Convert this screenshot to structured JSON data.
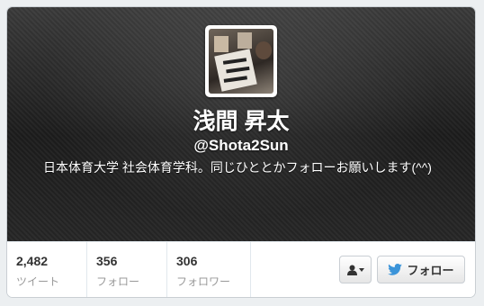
{
  "profile": {
    "name": "浅間 昇太",
    "handle": "@Shota2Sun",
    "bio": "日本体育大学 社会体育学科。同じひととかフォローお願いします(^^)"
  },
  "stats": [
    {
      "value": "2,482",
      "label": "ツイート"
    },
    {
      "value": "356",
      "label": "フォロー"
    },
    {
      "value": "306",
      "label": "フォロワー"
    }
  ],
  "actions": {
    "user_menu_icon": "person-icon",
    "follow_label": "フォロー",
    "follow_icon": "twitter-bird-icon"
  },
  "colors": {
    "twitter_blue": "#3b94d9",
    "header_dark": "#262626"
  }
}
